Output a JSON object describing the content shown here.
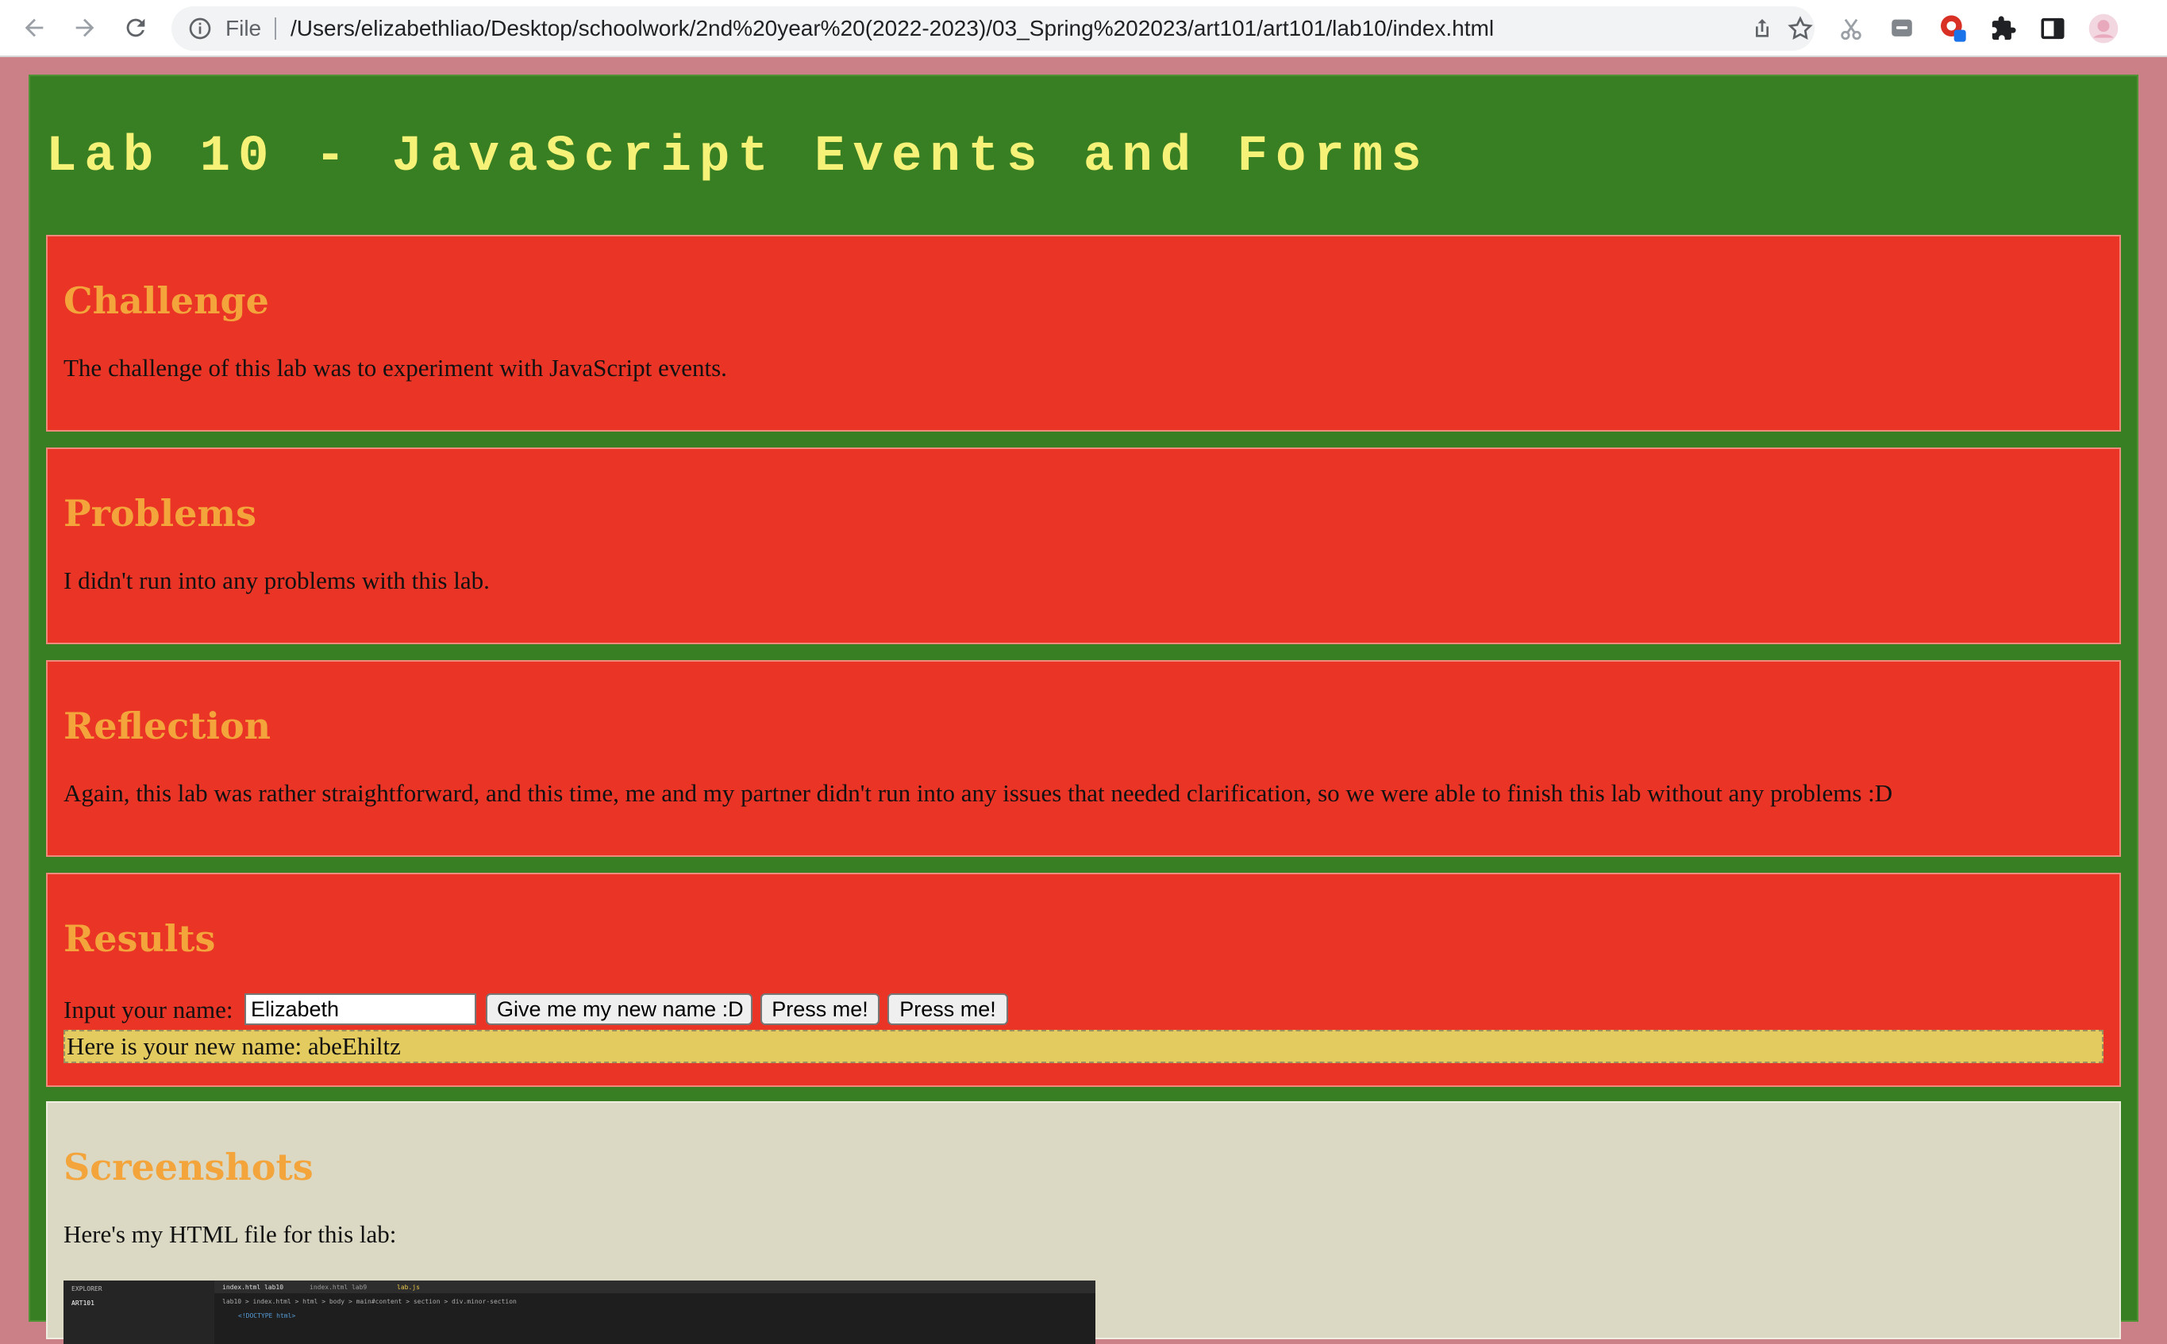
{
  "browser": {
    "scheme_label": "File",
    "url": "/Users/elizabethliao/Desktop/schoolwork/2nd%20year%20(2022-2023)/03_Spring%202023/art101/art101/lab10/index.html",
    "icons": [
      "back-arrow-icon",
      "forward-arrow-icon",
      "reload-icon",
      "info-icon",
      "share-icon",
      "star-icon",
      "scissors-icon",
      "chat-icon",
      "record-icon",
      "puzzle-icon",
      "sidepanel-icon",
      "avatar"
    ]
  },
  "page": {
    "title": "Lab 10 - JavaScript Events and Forms",
    "colors": {
      "page_bg": "#cb8088",
      "panel_bg": "#387e22",
      "section_bg": "#e93426",
      "heading": "#f3a43a",
      "title": "#f6f277",
      "output_bg": "#e3cb5f",
      "screenshots_bg": "#dbd9c4"
    }
  },
  "sections": {
    "challenge": {
      "heading": "Challenge",
      "body": "The challenge of this lab was to experiment with JavaScript events."
    },
    "problems": {
      "heading": "Problems",
      "body": "I didn't run into any problems with this lab."
    },
    "reflection": {
      "heading": "Reflection",
      "body": "Again, this lab was rather straightforward, and this time, me and my partner didn't run into any issues that needed clarification, so we were able to finish this lab without any problems :D"
    },
    "results": {
      "heading": "Results",
      "input_label": "Input your name:",
      "input_value": "Elizabeth",
      "give_button": "Give me my new name :D",
      "press_button_1": "Press me!",
      "press_button_2": "Press me!",
      "output": "Here is your new name: abeEhiltz"
    },
    "screenshots": {
      "heading": "Screenshots",
      "body": "Here's my HTML file for this lab:",
      "thumb": {
        "explorer": "EXPLORER",
        "folder": "ART101",
        "tab1": "index.html lab10",
        "tab2": "index.html lab9",
        "tab3": "lab.js",
        "breadcrumb": "lab10 > index.html > html > body > main#content > section > div.minor-section",
        "line1": "<!DOCTYPE html>"
      }
    }
  }
}
